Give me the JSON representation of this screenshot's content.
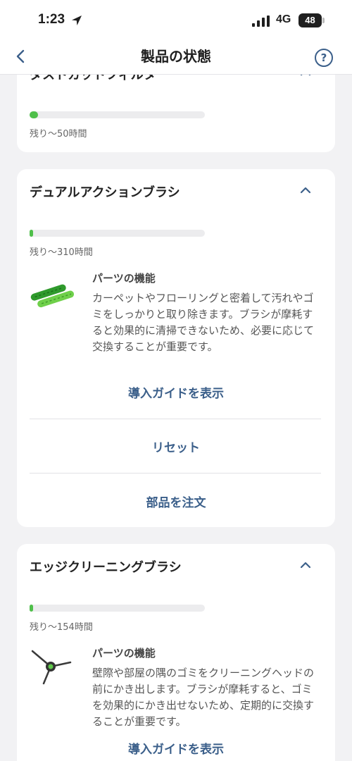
{
  "status_bar": {
    "time": "1:23",
    "network": "4G",
    "battery": "48"
  },
  "header": {
    "title": "製品の状態",
    "help": "?"
  },
  "cards": [
    {
      "title": "ダストカットフィルター",
      "progress": 0.05,
      "remaining": "残り〜50時間"
    },
    {
      "title": "デュアルアクションブラシ",
      "progress": 0.015,
      "remaining": "残り〜310時間",
      "feature_heading": "パーツの機能",
      "feature_text": "カーペットやフローリングと密着して汚れやゴミをしっかりと取り除きます。ブラシが摩耗すると効果的に清掃できないため、必要に応じて交換することが重要です。",
      "guide_link": "導入ガイドを表示",
      "reset": "リセット",
      "order": "部品を注文"
    },
    {
      "title": "エッジクリーニングブラシ",
      "progress": 0.015,
      "remaining": "残り〜154時間",
      "feature_heading": "パーツの機能",
      "feature_text": "壁際や部屋の隅のゴミをクリーニングヘッドの前にかき出します。ブラシが摩耗すると、ゴミを効果的にかき出せないため、定期的に交換することが重要です。",
      "guide_link": "導入ガイドを表示"
    }
  ],
  "colors": {
    "accent": "#3b5f8a",
    "progress": "#4fbf4a",
    "background": "#f2f2f4"
  }
}
